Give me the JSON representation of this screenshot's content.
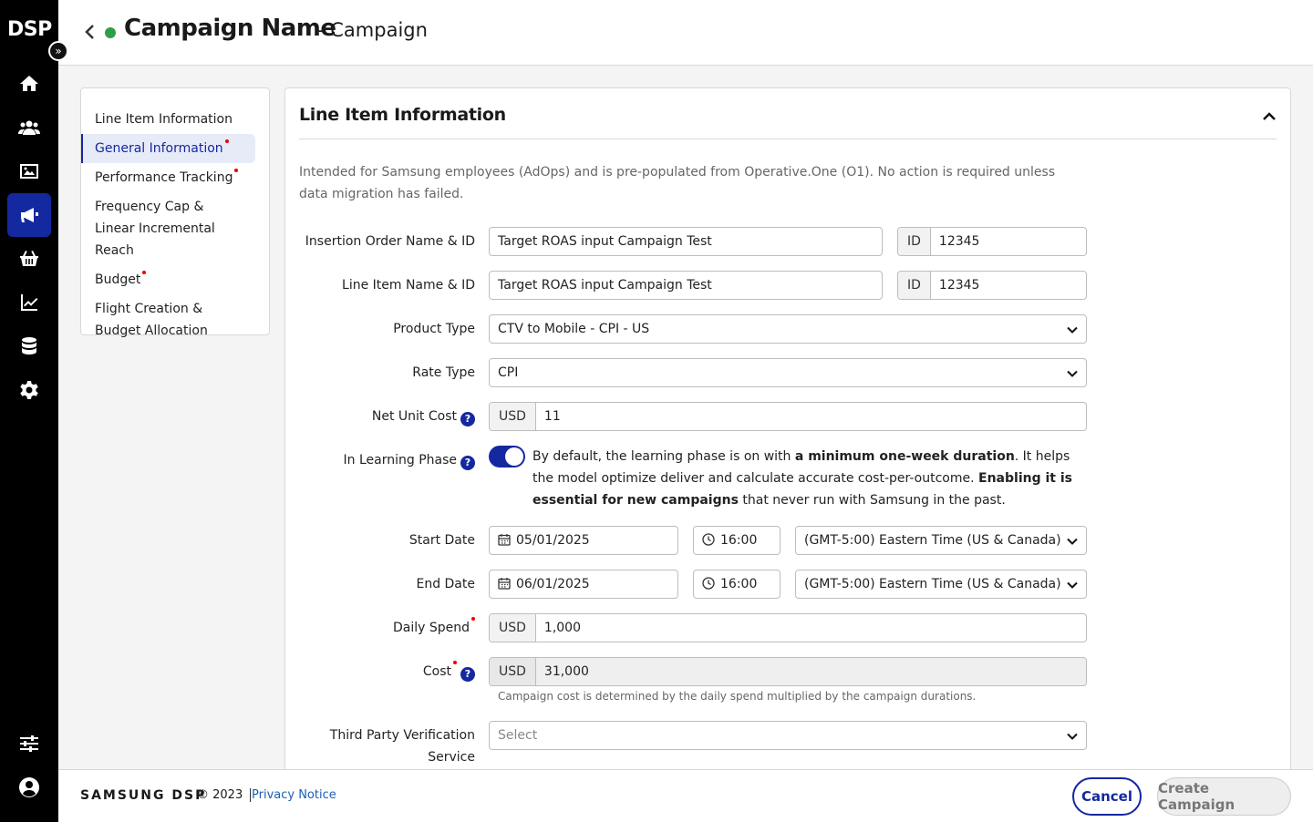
{
  "app": {
    "logo": "DSP"
  },
  "header": {
    "title": "Campaign Name",
    "subtitle": "- Campaign"
  },
  "side_nav": {
    "items": [
      {
        "label": "Line Item Information"
      },
      {
        "label": "General Information"
      },
      {
        "label": "Performance Tracking"
      },
      {
        "label": "Frequency Cap &"
      },
      {
        "label": "Linear Incremental Reach"
      },
      {
        "label": "Budget"
      },
      {
        "label": "Flight Creation &"
      },
      {
        "label": "Budget Allocation"
      }
    ]
  },
  "panel": {
    "title": "Line Item Information",
    "description": "Intended for Samsung employees (AdOps) and is pre-populated from Operative.One (O1). No action is required unless data migration has failed."
  },
  "form": {
    "insertion_order": {
      "label": "Insertion Order Name & ID",
      "name": "Target ROAS input Campaign Test",
      "id_addon": "ID",
      "id": "12345"
    },
    "line_item": {
      "label": "Line Item Name & ID",
      "name": "Target ROAS input Campaign Test",
      "id_addon": "ID",
      "id": "12345"
    },
    "product_type": {
      "label": "Product Type",
      "value": "CTV to Mobile - CPI - US"
    },
    "rate_type": {
      "label": "Rate Type",
      "value": "CPI"
    },
    "net_unit_cost": {
      "label": "Net Unit Cost",
      "currency": "USD",
      "value": "11"
    },
    "learning_phase": {
      "label": "In Learning Phase",
      "enabled": true,
      "text_1": "By default, the learning phase is on with ",
      "bold_1": "a minimum one-week duration",
      "text_2": ". It helps the model optimize deliver and calculate accurate cost-per-outcome. ",
      "bold_2": "Enabling it is essential for new campaigns",
      "text_3": " that never run with Samsung in the past."
    },
    "start_date": {
      "label": "Start Date",
      "date": "05/01/2025",
      "time": "16:00",
      "timezone": "(GMT-5:00) Eastern Time (US & Canada)"
    },
    "end_date": {
      "label": "End Date",
      "date": "06/01/2025",
      "time": "16:00",
      "timezone": "(GMT-5:00) Eastern Time (US & Canada)"
    },
    "daily_spend": {
      "label": "Daily Spend",
      "currency": "USD",
      "value": "1,000"
    },
    "cost": {
      "label": "Cost",
      "currency": "USD",
      "value": "31,000",
      "hint": "Campaign cost is determined by the daily spend multiplied by the campaign durations."
    },
    "third_party": {
      "label_1": "Third Party Verification",
      "label_2": "Service",
      "placeholder": "Select"
    }
  },
  "footer": {
    "brand": "SAMSUNG DSP",
    "copyright": "© 2023",
    "privacy": "Privacy Notice",
    "cancel": "Cancel",
    "create": "Create Campaign"
  },
  "colors": {
    "accent": "#1428a0",
    "status_active": "#2ea043",
    "required": "#e00000"
  },
  "icons": [
    "home-icon",
    "users-icon",
    "image-icon",
    "megaphone-icon",
    "basket-icon",
    "chart-icon",
    "database-icon",
    "gear-icon",
    "sliders-icon",
    "user-icon"
  ]
}
